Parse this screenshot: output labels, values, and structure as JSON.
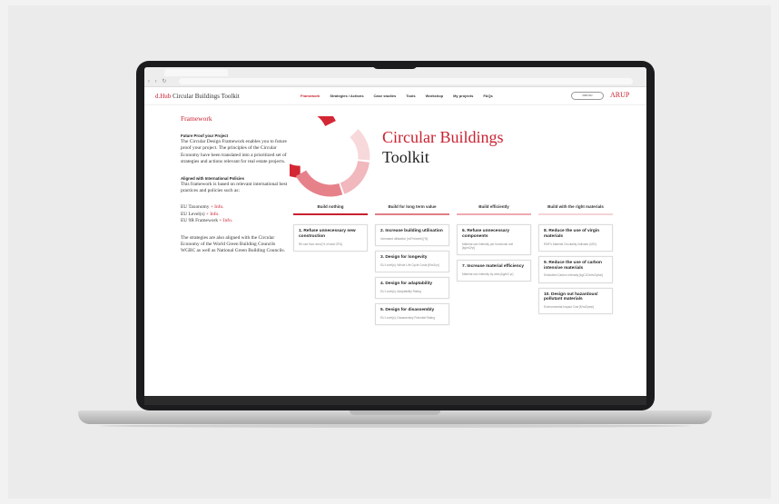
{
  "header": {
    "brand_prefix": "d.Hub",
    "brand_suffix": " Circular Buildings Toolkit",
    "nav": [
      "Framework",
      "Strategies / Actions",
      "Case studies",
      "Tools",
      "Workshop",
      "My projects",
      "FAQs"
    ],
    "active_nav": 0,
    "partner_logo": "WBCSD",
    "arup": "ARUP"
  },
  "left": {
    "heading": "Framework",
    "sub1": "Future Proof your Project",
    "text1": "The Circular Design Framework enables you to future proof your project. The principles of the Circular Economy have been translated into a prioritized set of strategies and actions relevant for real estate projects.",
    "sub2": "Aligned with International Policies",
    "text2": "This framework is based on relevant international best practices and policies such as:",
    "policies": [
      {
        "name": "EU Taxonomy",
        "link": "+ Info."
      },
      {
        "name": "EU Level(s)",
        "link": "+ Info."
      },
      {
        "name": "EU 9R Framework",
        "link": "+ Info."
      }
    ],
    "text3": "The strategies are also aligned with the Circular Economy of the World Green Building Councils WGBC as well as National Green Building Councils."
  },
  "hero": {
    "line1": "Circular Buildings",
    "line2": "Toolkit"
  },
  "colors": {
    "accent": "#c8202f",
    "c1": "#d42734",
    "c2": "#e6818a",
    "c3": "#f1b8bd",
    "c4": "#f7d9db"
  },
  "columns": [
    {
      "title": "Build nothing",
      "color": "#c8202f",
      "cards": [
        {
          "title": "1. Refuse unnecessary new construction",
          "sub": "Re-use floor area [% of total GFA]"
        }
      ]
    },
    {
      "title": "Build for long term value",
      "color": "#e17d86",
      "cards": [
        {
          "title": "2. Increase building utilisation",
          "sub": "Increased utilisation [m2*h/week] [%]"
        },
        {
          "title": "3. Design for longevity",
          "sub": "EU Level(s): Whole Life Cycle Costs [€/m2/yr]"
        },
        {
          "title": "4. Design for adaptability",
          "sub": "EU Level(s): Adaptability Rating"
        },
        {
          "title": "5. Design for disassembly",
          "sub": "EU Level(s): Disassembly Potential Rating"
        }
      ]
    },
    {
      "title": "Build efficiently",
      "color": "#eeaab0",
      "cards": [
        {
          "title": "6. Refuse unnecessary components",
          "sub": "Material use intensity per functional unit [kg/m2/yr]"
        },
        {
          "title": "7. Increase material efficiency",
          "sub": "Material use intensity by area [kg/m2 yr]"
        }
      ]
    },
    {
      "title": "Build with the right materials",
      "color": "#f5d3d6",
      "cards": [
        {
          "title": "8. Reduce the use of virgin materials",
          "sub": "EMF's Material Circularity Indicator (MCI)"
        },
        {
          "title": "9. Reduce the use of carbon intensive materials",
          "sub": "Embodied Carbon intensity [kgCO2e/m2/year]"
        },
        {
          "title": "10. Design out hazardous/ pollutant materials",
          "sub": "Environmental Impact Cost [€/m2/year]"
        }
      ]
    }
  ]
}
